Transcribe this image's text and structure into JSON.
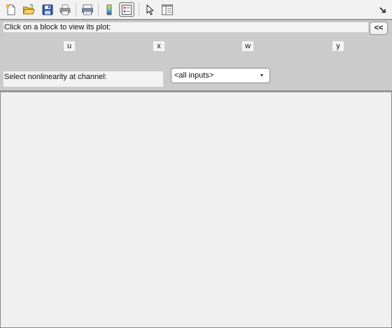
{
  "toolbar": {
    "buttons": [
      {
        "icon": "new-file-icon"
      },
      {
        "icon": "open-folder-icon"
      },
      {
        "icon": "save-icon"
      },
      {
        "icon": "print-icon"
      },
      {
        "icon": "print-preview-icon"
      },
      {
        "icon": "colorbar-icon"
      },
      {
        "icon": "legend-icon"
      },
      {
        "icon": "pointer-icon"
      },
      {
        "icon": "property-editor-icon"
      }
    ]
  },
  "panel": {
    "instruction": "Click on a block to view its plot:",
    "collapse_label": "<<",
    "blocks": [
      "u",
      "x",
      "w",
      "y"
    ],
    "channel_label": "Select nonlinearity at channel:",
    "channel_select": {
      "selected": "<all inputs>"
    }
  },
  "colors": {
    "panel_bg": "#cbcbcb",
    "window_bg": "#f0f0f0"
  }
}
